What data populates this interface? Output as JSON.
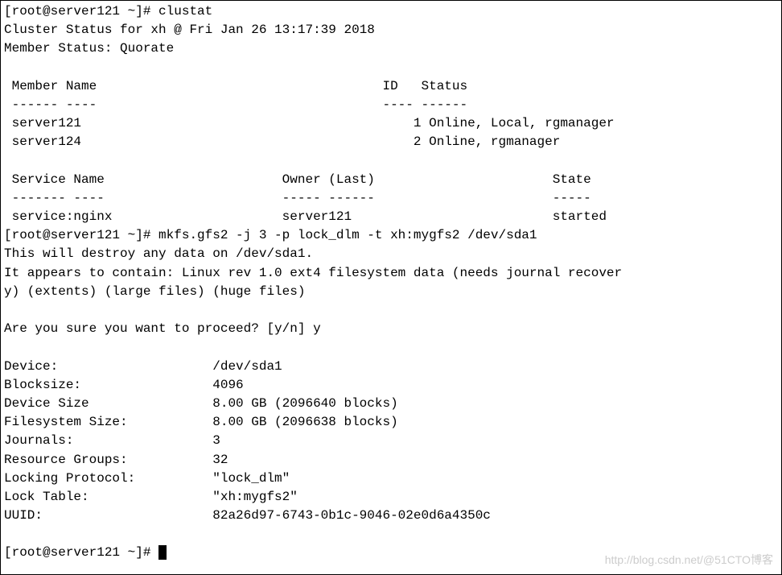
{
  "prompt1": "[root@server121 ~]# ",
  "cmd1": "clustat",
  "cluster_status_line": "Cluster Status for xh @ Fri Jan 26 13:17:39 2018",
  "member_status_line": "Member Status: Quorate",
  "member_header": " Member Name                                     ID   Status",
  "member_divider": " ------ ----                                     ---- ------",
  "member_row1": " server121                                           1 Online, Local, rgmanager",
  "member_row2": " server124                                           2 Online, rgmanager",
  "service_header": " Service Name                       Owner (Last)                       State",
  "service_divider": " ------- ----                       ----- ------                       -----",
  "service_row1": " service:nginx                      server121                          started",
  "prompt2": "[root@server121 ~]# ",
  "cmd2": "mkfs.gfs2 -j 3 -p lock_dlm -t xh:mygfs2 /dev/sda1",
  "destroy_line": "This will destroy any data on /dev/sda1.",
  "appears_line1": "It appears to contain: Linux rev 1.0 ext4 filesystem data (needs journal recover",
  "appears_line2": "y) (extents) (large files) (huge files)",
  "proceed_line": "Are you sure you want to proceed? [y/n] y",
  "device_line": "Device:                    /dev/sda1",
  "blocksize_line": "Blocksize:                 4096",
  "devicesize_line": "Device Size                8.00 GB (2096640 blocks)",
  "fssize_line": "Filesystem Size:           8.00 GB (2096638 blocks)",
  "journals_line": "Journals:                  3",
  "rg_line": "Resource Groups:           32",
  "lockproto_line": "Locking Protocol:          \"lock_dlm\"",
  "locktable_line": "Lock Table:                \"xh:mygfs2\"",
  "uuid_line": "UUID:                      82a26d97-6743-0b1c-9046-02e0d6a4350c",
  "prompt3": "[root@server121 ~]# ",
  "watermark": "http://blog.csdn.net/@51CTO博客"
}
